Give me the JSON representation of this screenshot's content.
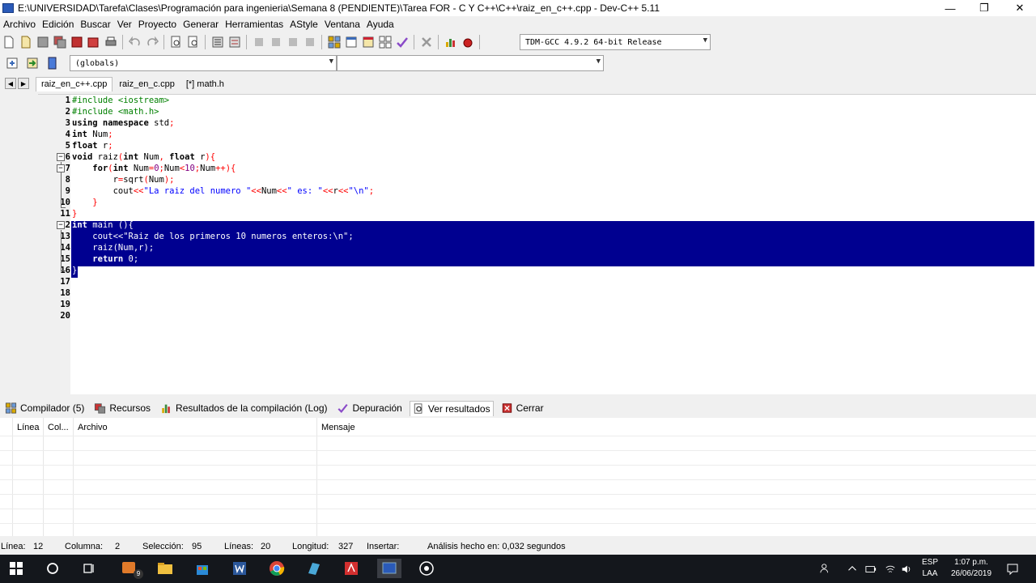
{
  "window": {
    "title": "E:\\UNIVERSIDAD\\Tarefa\\Clases\\Programación para ingenieria\\Semana 8 (PENDIENTE)\\Tarea FOR - C Y C++\\C++\\raiz_en_c++.cpp - Dev-C++ 5.11",
    "minimize": "—",
    "maximize": "❐",
    "close": "✕"
  },
  "menu": [
    "Archivo",
    "Edición",
    "Buscar",
    "Ver",
    "Proyecto",
    "Generar",
    "Herramientas",
    "AStyle",
    "Ventana",
    "Ayuda"
  ],
  "toolbar": {
    "compiler_select": "TDM-GCC 4.9.2 64-bit Release",
    "scope_select": "(globals)",
    "member_select": ""
  },
  "file_tabs": [
    {
      "label": "raiz_en_c++.cpp",
      "active": true
    },
    {
      "label": "raiz_en_c.cpp",
      "active": false
    },
    {
      "label": "[*] math.h",
      "active": false
    }
  ],
  "editor": {
    "line_numbers": [
      "1",
      "2",
      "3",
      "4",
      "5",
      "6",
      "7",
      "8",
      "9",
      "10",
      "11",
      "12",
      "13",
      "14",
      "15",
      "16",
      "17",
      "18",
      "19",
      "20"
    ]
  },
  "bottom_tabs": [
    {
      "label": "Compilador (5)",
      "icon": "compiler-grid-icon"
    },
    {
      "label": "Recursos",
      "icon": "resources-icon"
    },
    {
      "label": "Resultados de la compilación (Log)",
      "icon": "bar-chart-icon"
    },
    {
      "label": "Depuración",
      "icon": "check-icon"
    },
    {
      "label": "Ver resultados",
      "icon": "search-results-icon"
    },
    {
      "label": "Cerrar",
      "icon": "close-panel-icon"
    }
  ],
  "grid_headers": {
    "line": "Línea",
    "col": "Col...",
    "file": "Archivo",
    "message": "Mensaje"
  },
  "status": {
    "line_label": "Línea:",
    "line_value": "12",
    "col_label": "Columna:",
    "col_value": "2",
    "sel_label": "Selección:",
    "sel_value": "95",
    "lines_label": "Líneas:",
    "lines_value": "20",
    "length_label": "Longitud:",
    "length_value": "327",
    "insert_label": "Insertar:",
    "analysis": "Análisis hecho en: 0,032 segundos"
  },
  "taskbar": {
    "lang_top": "ESP",
    "lang_bottom": "LAA",
    "time": "1:07 p.m.",
    "date": "26/06/2019",
    "badge": "9"
  },
  "colors": {
    "selection": "#000090",
    "keyword": "#000000",
    "preprocessor": "#008000",
    "string": "#0000ff",
    "symbol": "#ff0000"
  }
}
